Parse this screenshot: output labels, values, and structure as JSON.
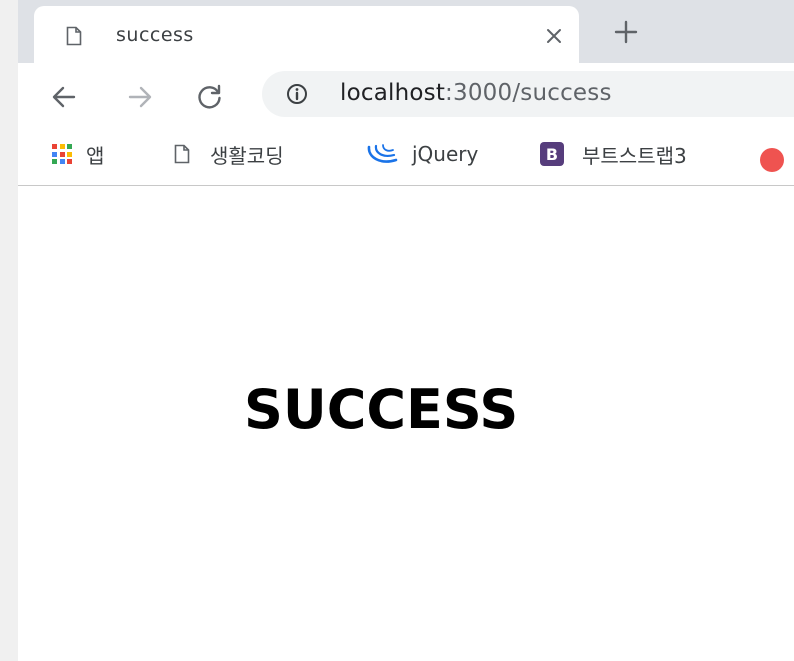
{
  "tab": {
    "title": "success",
    "icon": "document-icon",
    "close_icon": "close-icon",
    "new_tab_icon": "plus-icon"
  },
  "toolbar": {
    "back_icon": "arrow-left-icon",
    "forward_icon": "arrow-right-icon",
    "reload_icon": "reload-icon",
    "address": {
      "info_icon": "info-icon",
      "host": "localhost",
      "rest": ":3000/success"
    }
  },
  "bookmarks": {
    "items": [
      {
        "label": "앱",
        "icon": "apps-grid-icon"
      },
      {
        "label": "생활코딩",
        "icon": "document-icon"
      },
      {
        "label": "jQuery",
        "icon": "jquery-icon"
      },
      {
        "label": "부트스트랩3",
        "icon": "bootstrap-icon",
        "badge": "B"
      }
    ]
  },
  "page": {
    "heading": "SUCCESS"
  },
  "colors": {
    "tabstrip": "#dee1e6",
    "omnibox": "#f1f3f4",
    "bootstrap": "#563d7c",
    "jquery": "#1a73e8",
    "apps": [
      "#ea4335",
      "#fbbc05",
      "#34a853",
      "#4285f4"
    ]
  }
}
